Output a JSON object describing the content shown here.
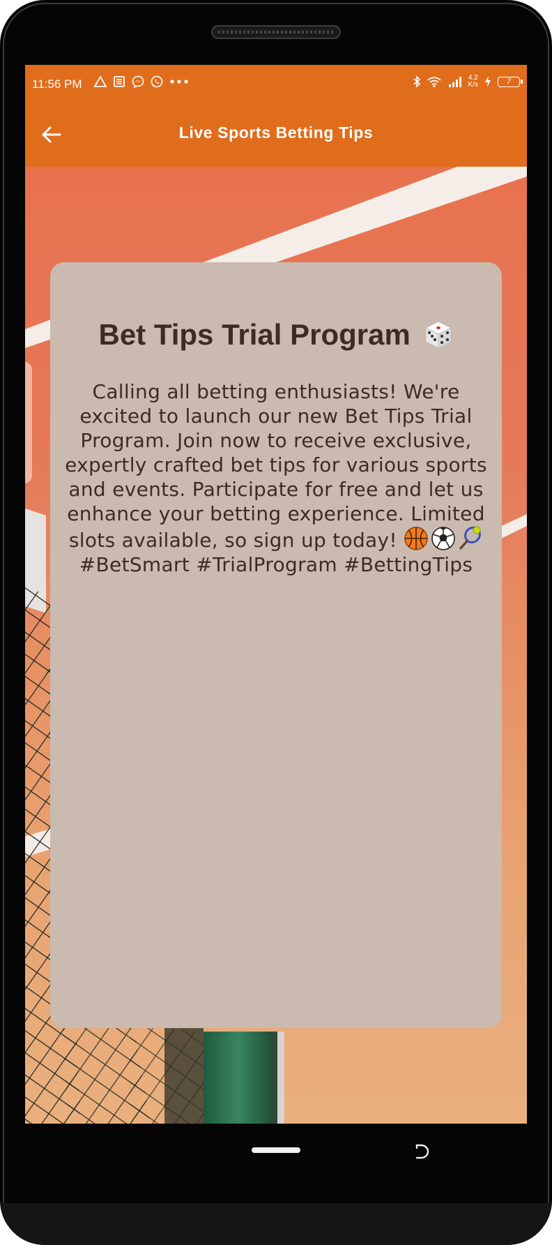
{
  "status_bar": {
    "time": "11:56 PM",
    "left_icons": [
      "alert-triangle-icon",
      "news-icon",
      "messenger-icon",
      "whatsapp-icon",
      "more-dots-icon"
    ],
    "net_speed_value": "4.2",
    "net_speed_unit": "K/s",
    "right_icons": [
      "bluetooth-icon",
      "wifi-icon",
      "signal-icon",
      "charging-icon",
      "battery-icon"
    ],
    "battery_level": "7"
  },
  "app_bar": {
    "title": "Live Sports Betting Tips",
    "back_icon": "arrow-left-icon"
  },
  "card": {
    "title": "Bet Tips Trial Program",
    "title_icon": "dice-icon",
    "body": "Calling all betting enthusiasts! We're excited to launch our new Bet Tips Trial Program. Join now to receive exclusive, expertly crafted bet tips for various sports and events. Participate for free and let us enhance your betting experience. Limited slots available, so sign up today!",
    "emojis": [
      "basketball-icon",
      "soccer-ball-icon",
      "tennis-icon"
    ],
    "hashtags": "#BetSmart #TrialProgram #BettingTips"
  },
  "colors": {
    "app_bar": "#e06d1c",
    "card_background": "#cbbaaf",
    "card_text": "#3e2c23"
  }
}
